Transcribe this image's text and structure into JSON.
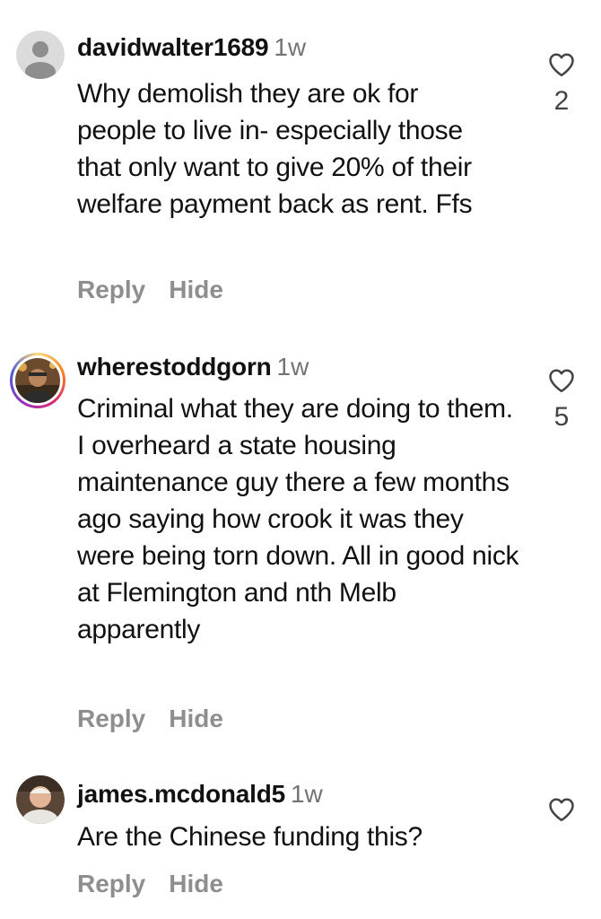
{
  "comments": [
    {
      "username": "davidwalter1689",
      "time": "1w",
      "text": "Why demolish they are ok for people to live in- especially those that only want to give 20% of their welfare payment back as rent. Ffs",
      "reply_label": "Reply",
      "hide_label": "Hide",
      "likes": "2",
      "avatar": "default-avatar"
    },
    {
      "username": "wherestoddgorn",
      "time": "1w",
      "text": "Criminal what they are doing to them. I overheard a state housing maintenance guy there a few months ago saying how crook it was they were being torn down. All in good nick at Flemington and nth Melb apparently",
      "reply_label": "Reply",
      "hide_label": "Hide",
      "likes": "5",
      "avatar": "photo-avatar-story-ring"
    },
    {
      "username": "james.mcdonald5",
      "time": "1w",
      "text": "Are the Chinese funding this?",
      "reply_label": "Reply",
      "hide_label": "Hide",
      "likes": "",
      "avatar": "photo-avatar"
    }
  ],
  "colors": {
    "text": "#111111",
    "muted": "#8e8e8e",
    "time": "#737373",
    "heart": "#444444"
  },
  "icons": {
    "like": "heart-outline-icon",
    "default_avatar": "person-silhouette-icon"
  }
}
